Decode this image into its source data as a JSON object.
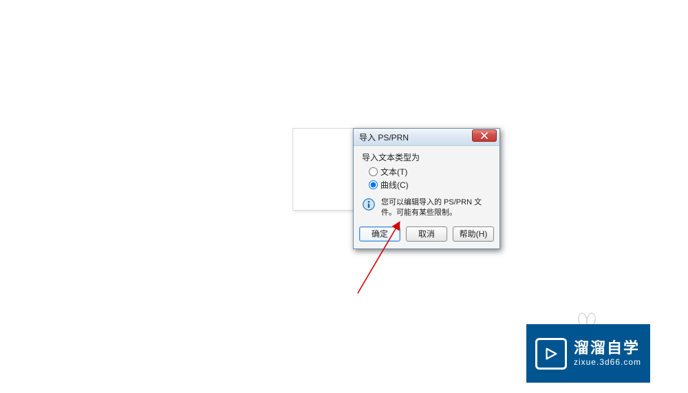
{
  "dialog": {
    "title": "导入 PS/PRN",
    "close_label": "×",
    "group_label": "导入文本类型为",
    "radios": {
      "text_label": "文本(T)",
      "curve_label": "曲线(C)"
    },
    "info_text": "您可以编辑导入的 PS/PRN 文件。可能有某些限制。",
    "buttons": {
      "ok": "确定",
      "cancel": "取消",
      "help": "帮助(H)"
    }
  },
  "watermark": {
    "title": "溜溜自学",
    "url": "zixue.3d66.com"
  }
}
